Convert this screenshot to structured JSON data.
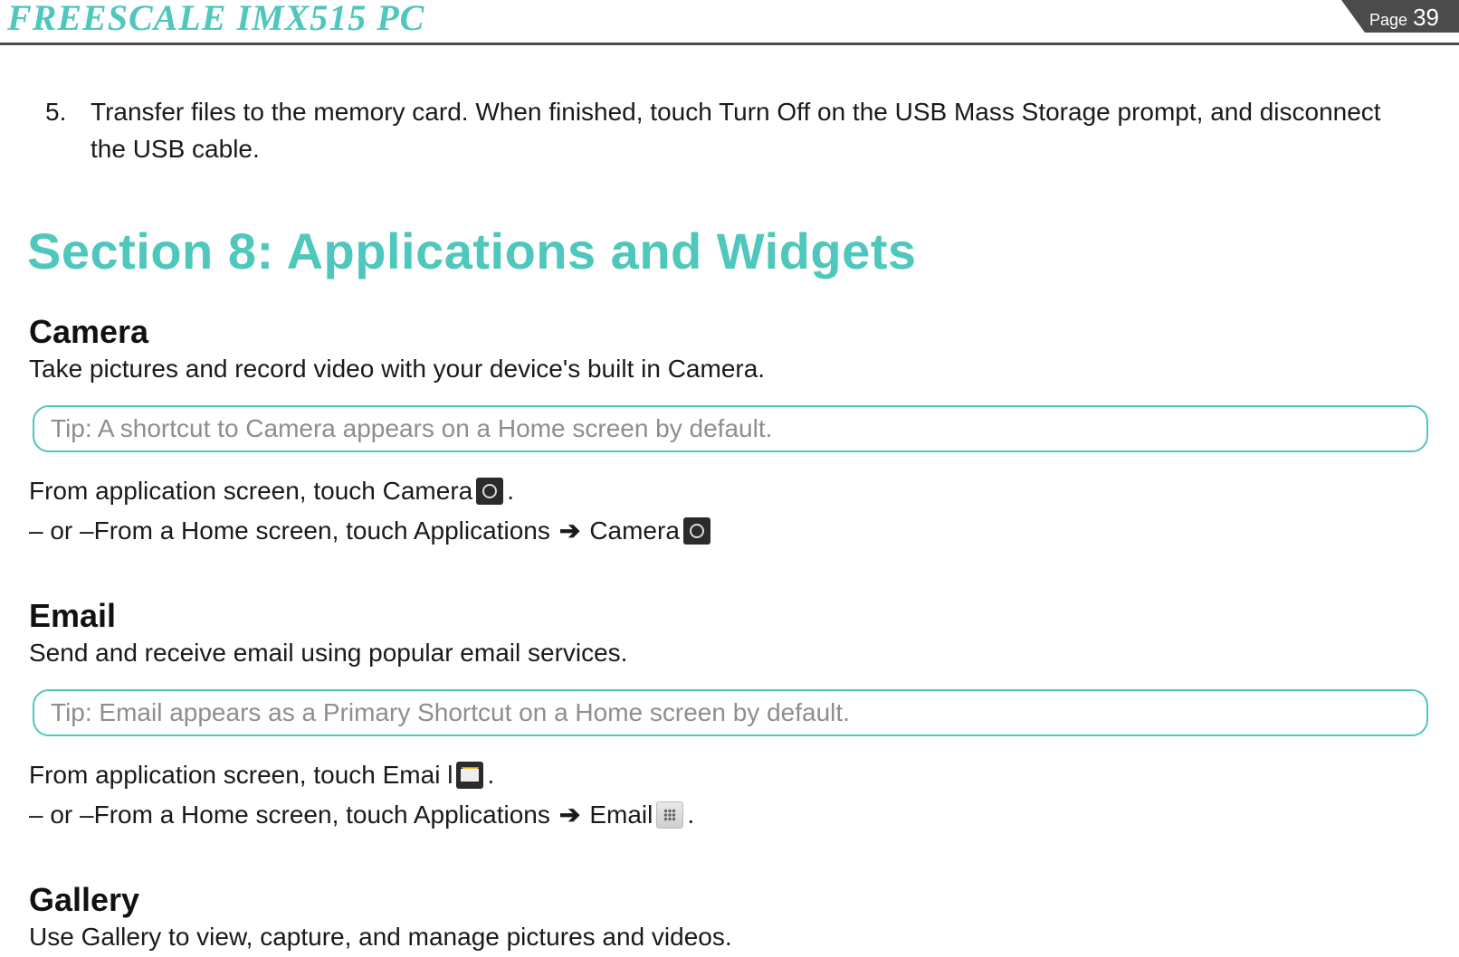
{
  "header": {
    "title": "FREESCALE  IMX515  PC",
    "page_label": "Page",
    "page_number": "39"
  },
  "step5": {
    "num": "5.",
    "text": "Transfer files to the memory card. When finished, touch Turn Off on the USB Mass Storage prompt, and disconnect the USB cable."
  },
  "section": {
    "title": "Section 8: Applications and Widgets"
  },
  "camera": {
    "heading": "Camera",
    "desc": "Take pictures and record video with your device's built in Camera.",
    "tip": "Tip: A shortcut to Camera appears on a Home screen by default.",
    "line1a": "From application screen, touch Camera",
    "line1b": ".",
    "line2a": "– or –From a Home screen, touch Applications  ",
    "arrow": "➔",
    "line2b": " Camera"
  },
  "email": {
    "heading": "Email",
    "desc": "Send and receive email using popular email services.",
    "tip": "Tip: Email appears as a Primary Shortcut on a Home screen by default.",
    "line1a": "From application screen, touch Emai l",
    "line1b": ".",
    "line2a": "– or –From a Home screen, touch Applications   ",
    "arrow": "➔",
    "line2b": " Email",
    "line2c": " ."
  },
  "gallery": {
    "heading": "Gallery",
    "desc": "Use Gallery to view, capture, and manage pictures and videos."
  },
  "icons": {
    "camera": "camera-icon",
    "email": "email-icon",
    "grid": "app-grid-icon"
  }
}
